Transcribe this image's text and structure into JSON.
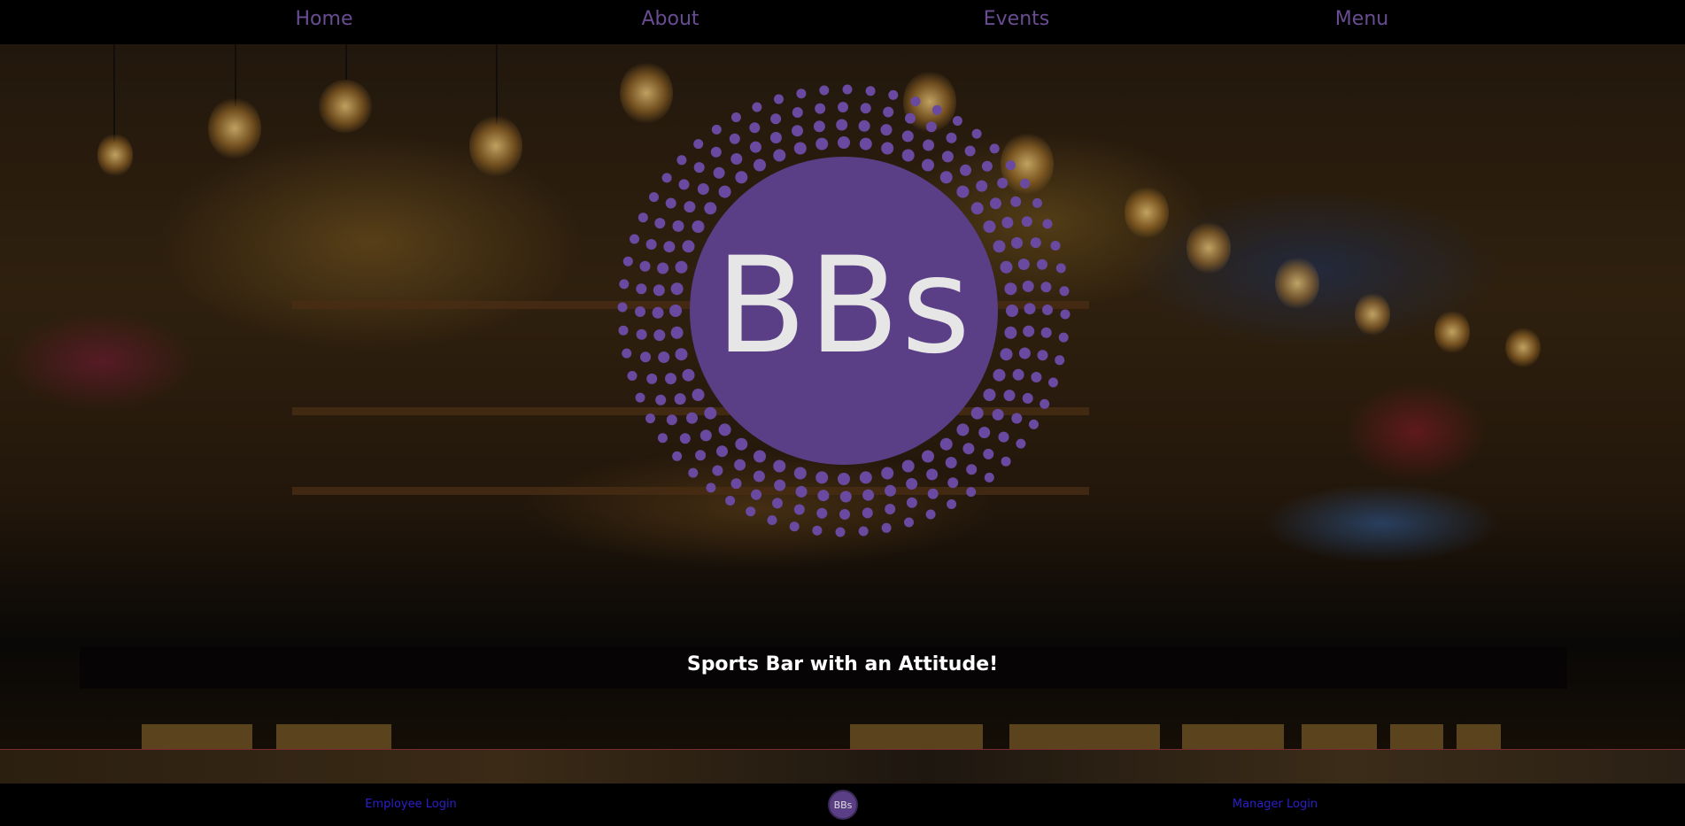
{
  "nav": {
    "items": [
      {
        "label": "Home"
      },
      {
        "label": "About"
      },
      {
        "label": "Events"
      },
      {
        "label": "Menu"
      }
    ]
  },
  "hero": {
    "logo_text": "BBs",
    "tagline": "Sports Bar with an Attitude!"
  },
  "footer": {
    "employee_login": "Employee Login",
    "logo_text": "BBs",
    "manager_login": "Manager Login"
  },
  "colors": {
    "brand_purple": "#5b3f86",
    "nav_link": "#6a4c93",
    "login_link": "#2c1fc9"
  }
}
